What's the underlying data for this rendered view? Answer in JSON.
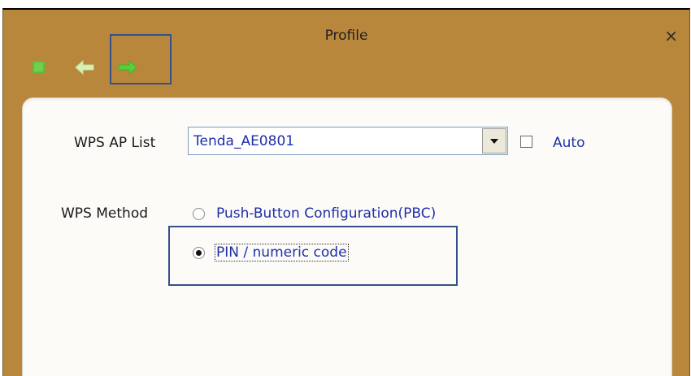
{
  "window": {
    "title": "Profile",
    "close_glyph": "×"
  },
  "toolbar": {
    "items": [
      {
        "name": "stop-square-icon",
        "color": "#5bbf3b"
      },
      {
        "name": "arrow-left-icon",
        "color": "#d7efb9"
      },
      {
        "name": "arrow-right-icon",
        "color": "#54d13a"
      }
    ]
  },
  "form": {
    "ap_list_label": "WPS AP List",
    "ap_list_selected": "Tenda_AE0801",
    "auto_label": "Auto",
    "auto_checked": false,
    "method_label": "WPS Method",
    "methods": [
      {
        "label": "Push-Button Configuration(PBC)",
        "selected": false
      },
      {
        "label": "PIN / numeric code",
        "selected": true
      }
    ]
  },
  "colors": {
    "window_bg": "#b9873c",
    "panel_bg": "#fcfbf8",
    "link_blue": "#1f2fa8",
    "highlight_box": "#35508a"
  }
}
